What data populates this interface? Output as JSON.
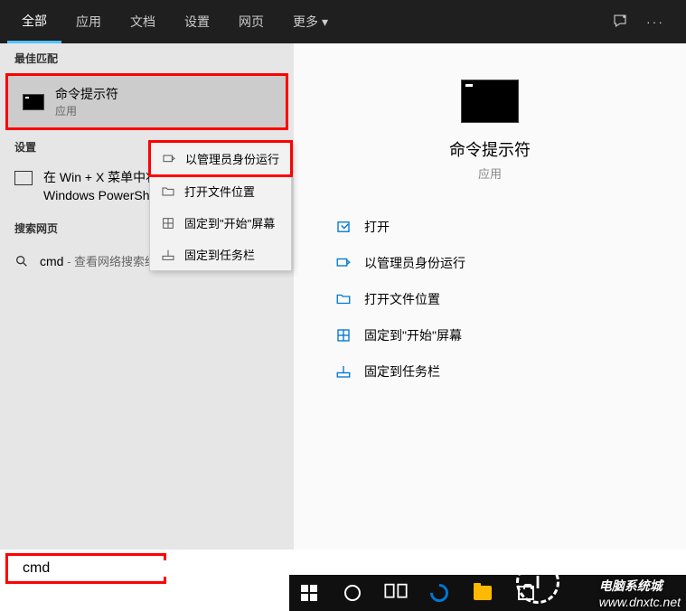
{
  "tabs": {
    "all": "全部",
    "apps": "应用",
    "docs": "文档",
    "settings": "设置",
    "web": "网页",
    "more": "更多"
  },
  "sections": {
    "best_match": "最佳匹配",
    "settings": "设置",
    "search_web": "搜索网页"
  },
  "best_match_result": {
    "title": "命令提示符",
    "subtitle": "应用"
  },
  "settings_result": {
    "text": "在 Win + X 菜单中将命令提示符替换为 Windows PowerShell"
  },
  "web_result": {
    "query": "cmd",
    "suffix": " - 查看网络搜索结果"
  },
  "context_menu": {
    "run_admin": "以管理员身份运行",
    "open_location": "打开文件位置",
    "pin_start": "固定到\"开始\"屏幕",
    "pin_taskbar": "固定到任务栏"
  },
  "preview": {
    "title": "命令提示符",
    "subtitle": "应用"
  },
  "actions": {
    "open": "打开",
    "run_admin": "以管理员身份运行",
    "open_location": "打开文件位置",
    "pin_start": "固定到\"开始\"屏幕",
    "pin_taskbar": "固定到任务栏"
  },
  "search_input": "cmd",
  "watermark": {
    "text_top": "电脑系统城",
    "url": "www.dnxtc.net"
  }
}
